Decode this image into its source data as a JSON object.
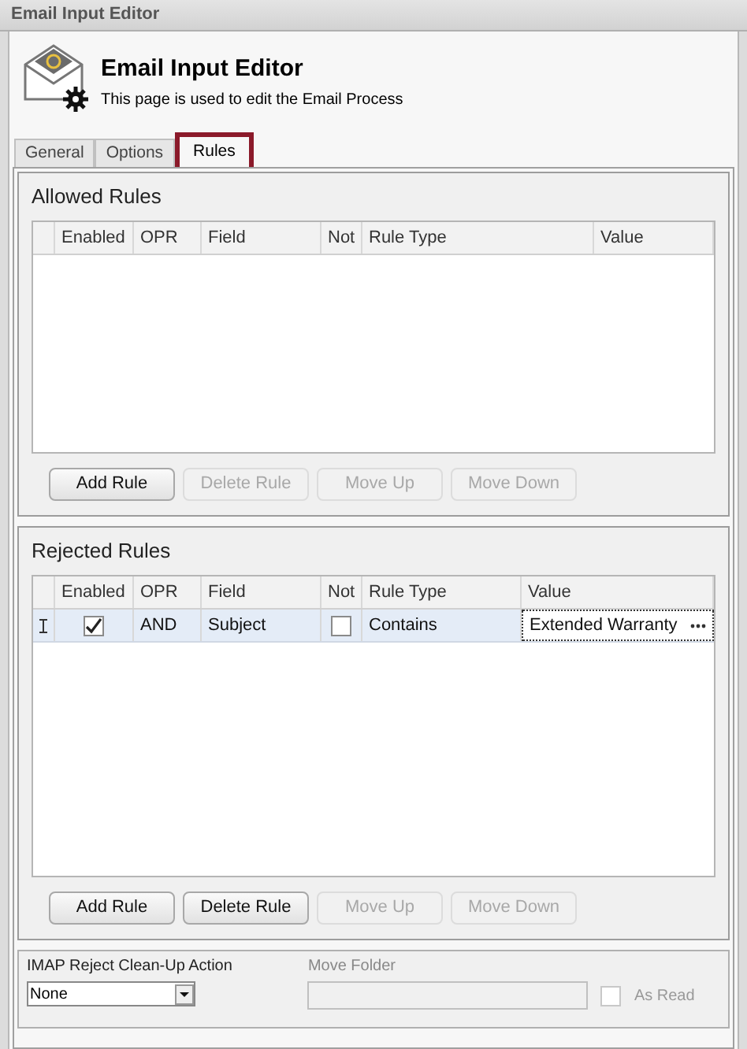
{
  "window": {
    "title": "Email Input Editor"
  },
  "header": {
    "title": "Email Input Editor",
    "subtitle": "This page is used to edit the Email Process"
  },
  "tabs": [
    {
      "label": "General",
      "selected": false,
      "highlighted": false
    },
    {
      "label": "Options",
      "selected": false,
      "highlighted": false
    },
    {
      "label": "Rules",
      "selected": true,
      "highlighted": true
    }
  ],
  "allowed_rules": {
    "title": "Allowed Rules",
    "columns": [
      "Enabled",
      "OPR",
      "Field",
      "Not",
      "Rule Type",
      "Value"
    ],
    "buttons": [
      {
        "label": "Add Rule",
        "disabled": false
      },
      {
        "label": "Delete Rule",
        "disabled": true
      },
      {
        "label": "Move Up",
        "disabled": true
      },
      {
        "label": "Move Down",
        "disabled": true
      }
    ]
  },
  "rejected_rules": {
    "title": "Rejected Rules",
    "columns": [
      "Enabled",
      "OPR",
      "Field",
      "Not",
      "Rule Type",
      "Value"
    ],
    "rows": [
      {
        "enabled": true,
        "opr": "AND",
        "field": "Subject",
        "not": false,
        "rule_type": "Contains",
        "value": "Extended Warranty",
        "editing": true
      }
    ],
    "buttons": [
      {
        "label": "Add Rule",
        "disabled": false
      },
      {
        "label": "Delete Rule",
        "disabled": false
      },
      {
        "label": "Move Up",
        "disabled": true
      },
      {
        "label": "Move Down",
        "disabled": true
      }
    ]
  },
  "imap": {
    "action_label": "IMAP Reject Clean-Up Action",
    "action_value": "None",
    "folder_label": "Move Folder",
    "folder_disabled": true,
    "as_read_label": "As Read",
    "as_read_checked": false,
    "as_read_disabled": true
  }
}
